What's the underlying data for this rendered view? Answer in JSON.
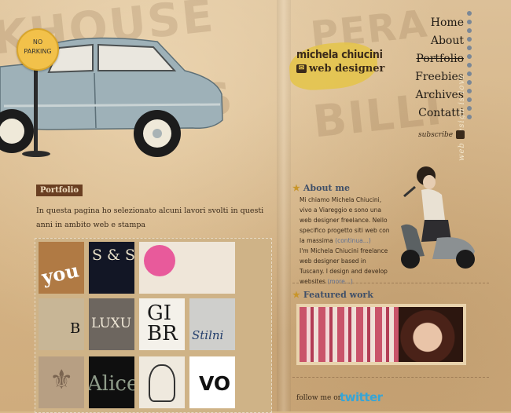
{
  "brand": {
    "name": "michela chiucini",
    "role": "web designer"
  },
  "sign": {
    "line1": "NO",
    "line2": "PARKING"
  },
  "nav": {
    "items": [
      "Home",
      "About",
      "Portfolio",
      "Freebies",
      "Archives",
      "Contatti"
    ],
    "current": "Portfolio"
  },
  "tagline": "web design is love",
  "subscribe": "subscribe",
  "background_words": [
    "KHOUSE",
    "PERA",
    "BILLI",
    "S"
  ],
  "portfolio": {
    "tag": "Portfolio",
    "intro": "In questa pagina ho selezionato alcuni lavori svolti in questi anni in ambito web e stampa",
    "thumbs": [
      "you",
      "S & S",
      "",
      "",
      "B",
      "LUXU",
      "GI BR",
      "Stilni",
      "",
      "Alice",
      "",
      "VO"
    ]
  },
  "about": {
    "title": "About me",
    "it": "Mi chiamo Michela Chiucini, vivo a Viareggio e sono una web designer freelance. Nello specifico progetto siti web con la massima",
    "it_more": "(continua...)",
    "en": "I'm Michela Chiucini freelance web designer based in Tuscany. I design and develop websites",
    "en_more": "(more...)"
  },
  "featured": {
    "title": "Featured work"
  },
  "follow": {
    "label": "follow me on",
    "service": "twitter"
  },
  "colors": {
    "accent_yellow": "#e4c44c",
    "nav_dots": "#7a8796",
    "heading_blue": "#3f4f68",
    "twitter": "#37a5d6"
  }
}
